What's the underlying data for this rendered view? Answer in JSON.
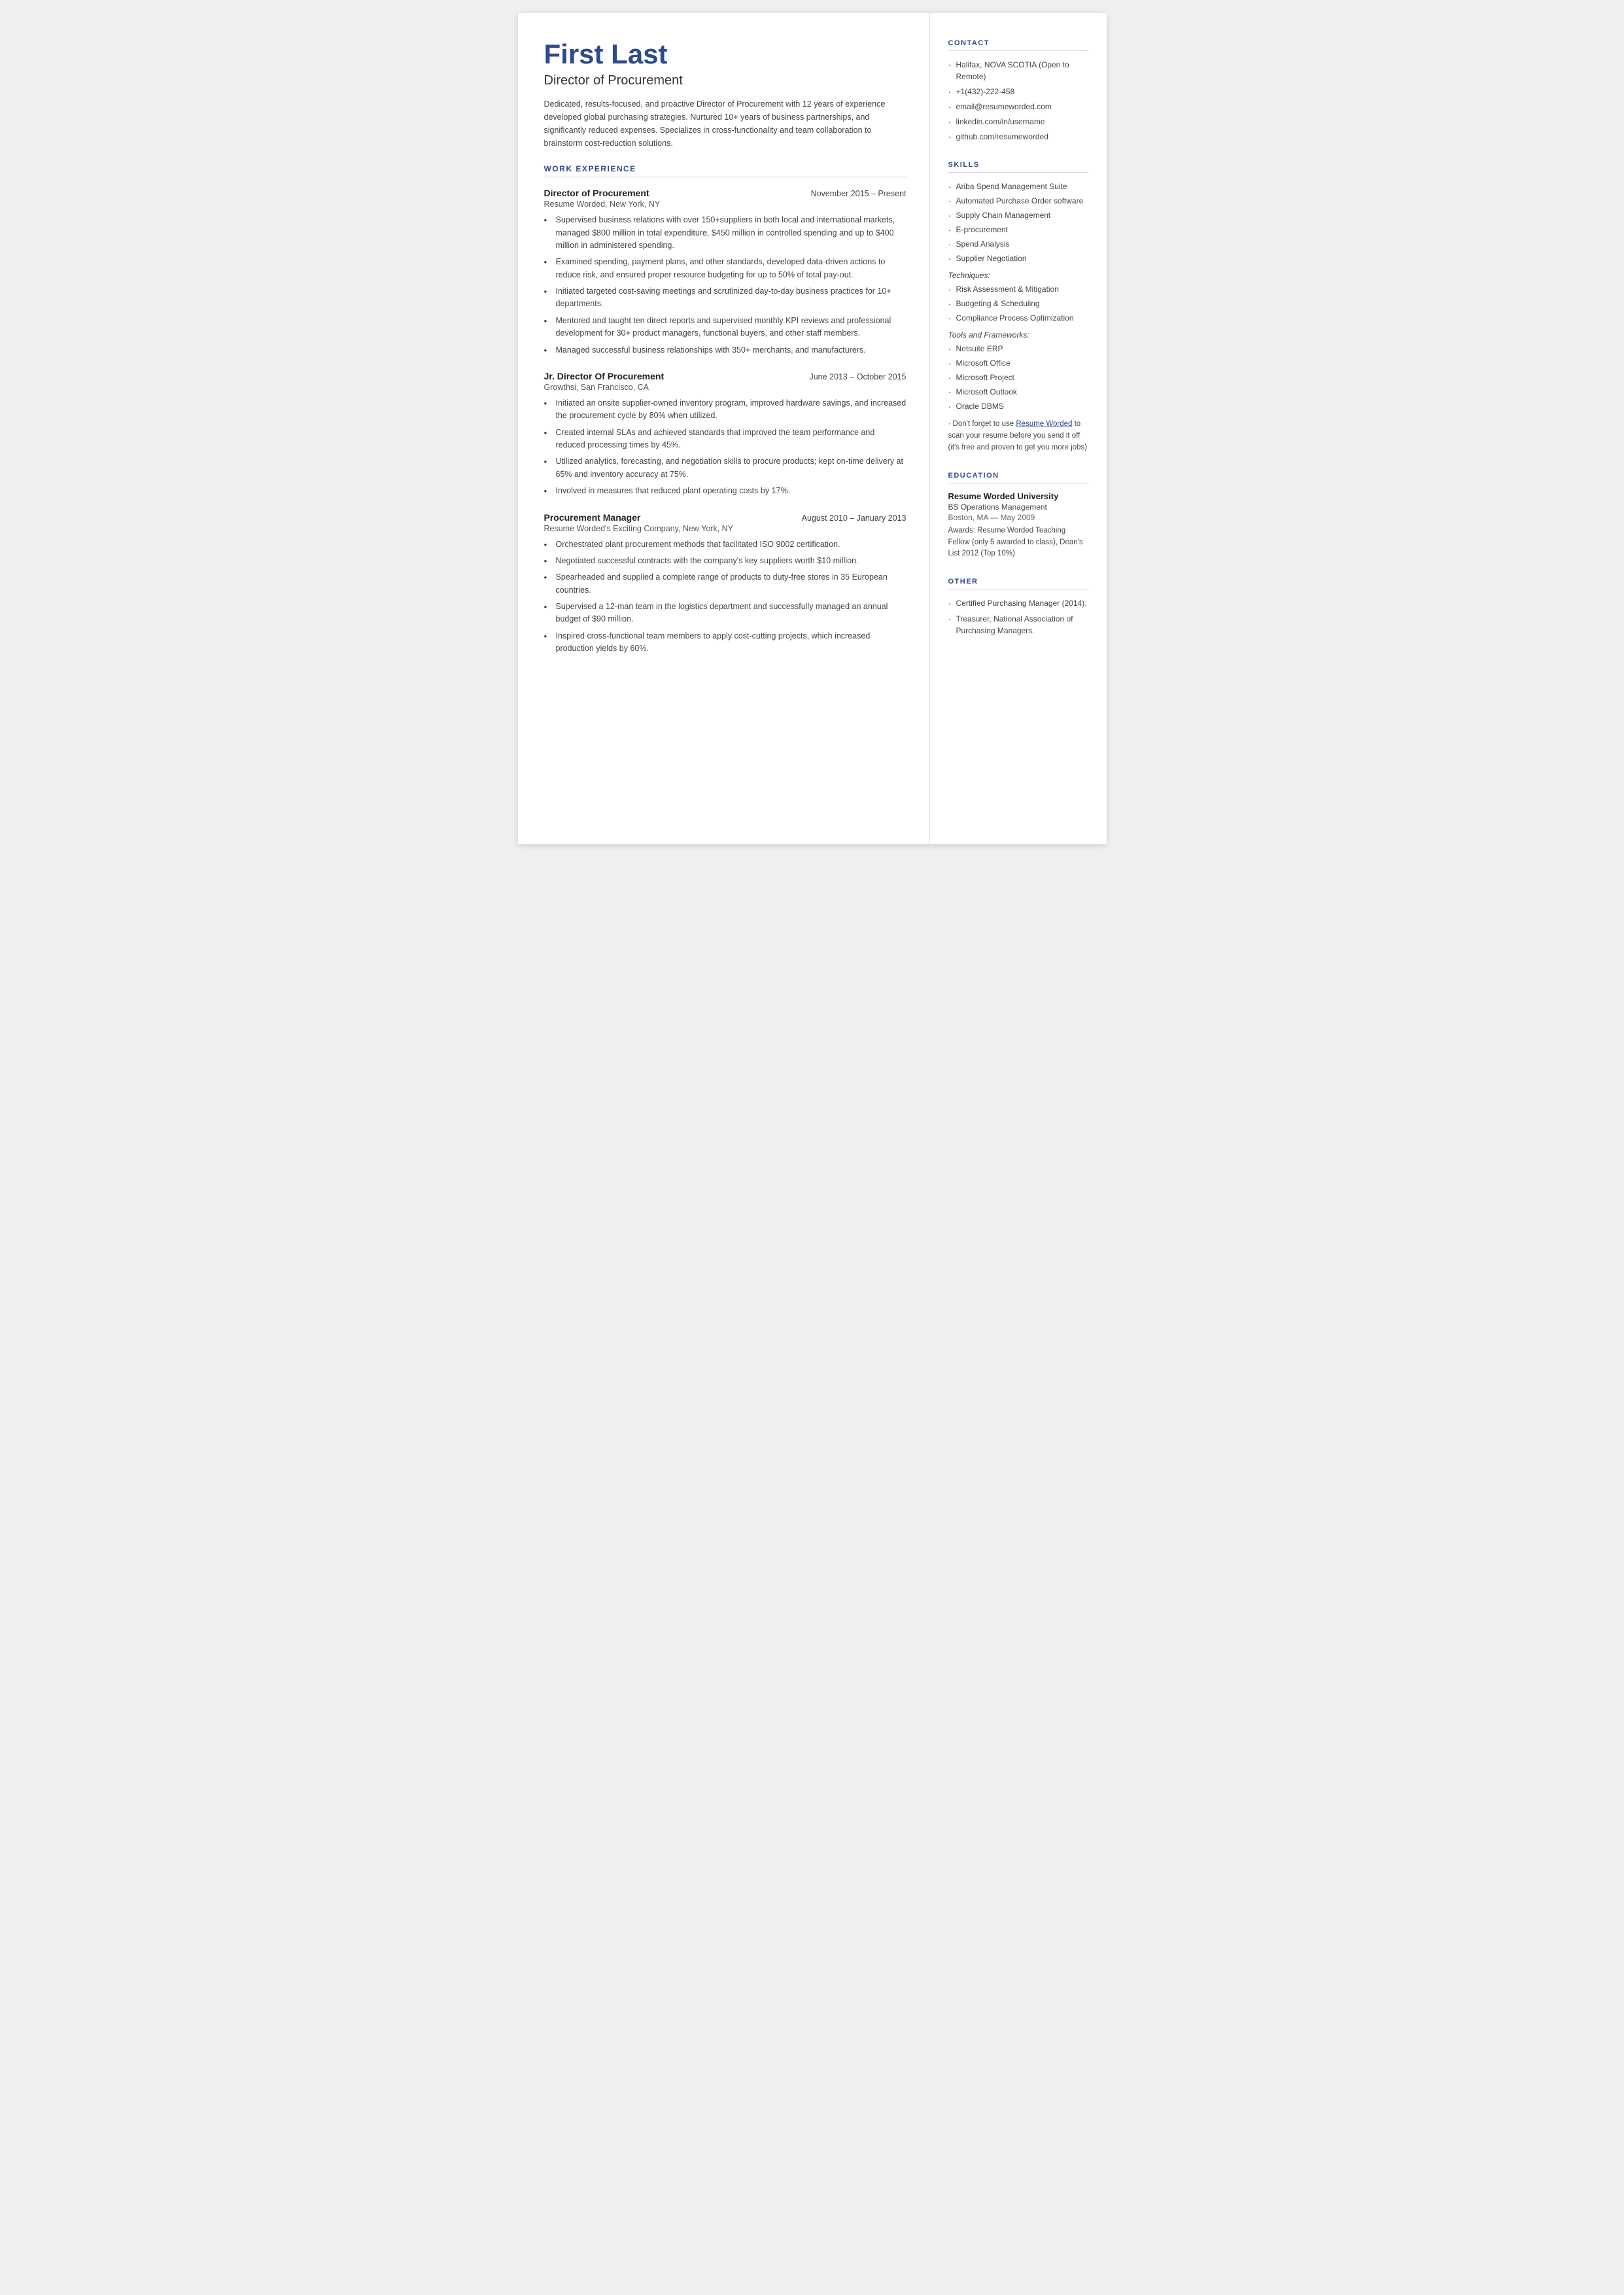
{
  "header": {
    "name": "First Last",
    "job_title": "Director of Procurement",
    "summary": "Dedicated, results-focused, and proactive Director of Procurement with 12 years of experience developed global purchasing strategies. Nurtured 10+ years of business partnerships, and significantly reduced expenses. Specializes in cross-functionality and team collaboration to brainstorm cost-reduction solutions."
  },
  "sections": {
    "work_experience_label": "WORK EXPERIENCE",
    "jobs": [
      {
        "position": "Director of Procurement",
        "dates": "November 2015 – Present",
        "company": "Resume Worded, New York, NY",
        "bullets": [
          "Supervised business relations with over 150+suppliers in both local and international markets, managed $800 million in total expenditure, $450 million in controlled spending and up to $400 million in administered spending.",
          "Examined spending, payment plans, and other standards, developed data-driven actions to reduce risk, and ensured proper resource budgeting for up to 50% of total pay-out.",
          "Initiated targeted cost-saving meetings and scrutinized day-to-day business practices for 10+ departments.",
          "Mentored and taught ten direct reports and supervised monthly KPI reviews and professional development for 30+ product managers, functional buyers, and other staff members.",
          "Managed successful business relationships with 350+ merchants, and manufacturers."
        ]
      },
      {
        "position": "Jr. Director Of Procurement",
        "dates": "June 2013 – October 2015",
        "company": "Growthsi, San Francisco, CA",
        "bullets": [
          "Initiated an onsite supplier-owned inventory program, improved hardware savings, and increased the procurement cycle by 80% when utilized.",
          "Created internal SLAs and achieved standards that improved the team performance and reduced processing times by 45%.",
          "Utilized analytics, forecasting, and negotiation skills to procure products; kept on-time delivery at 65% and inventory accuracy at 75%.",
          "Involved in measures that reduced plant operating costs by 17%."
        ]
      },
      {
        "position": "Procurement Manager",
        "dates": "August 2010 – January 2013",
        "company": "Resume Worded's Exciting Company, New York, NY",
        "bullets": [
          "Orchestrated plant procurement methods that facilitated ISO 9002 certification.",
          "Negotiated successful contracts with the company's key suppliers worth $10 million.",
          "Spearheaded and supplied a complete range of products to duty-free stores in 35 European countries.",
          "Supervised a 12-man team in the logistics department and successfully managed an annual budget of $90 million.",
          "Inspired cross-functional team members to apply cost-cutting projects, which increased production yields by 60%."
        ]
      }
    ]
  },
  "sidebar": {
    "contact": {
      "label": "CONTACT",
      "items": [
        "Halifax, NOVA SCOTIA (Open to Remote)",
        "+1(432)-222-458",
        "email@resumeworded.com",
        "linkedin.com/in/username",
        "github.com/resumeworded"
      ]
    },
    "skills": {
      "label": "SKILLS",
      "core_items": [
        "Ariba Spend Management Suite",
        "Automated Purchase Order software",
        "Supply Chain Management",
        "E-procurement",
        "Spend Analysis",
        "Supplier Negotiation"
      ],
      "techniques_label": "Techniques:",
      "techniques_items": [
        "Risk Assessment & Mitigation",
        "Budgeting & Scheduling",
        "Compliance Process Optimization"
      ],
      "tools_label": "Tools and Frameworks:",
      "tools_items": [
        "Netsuite ERP",
        "Microsoft Office",
        "Microsoft Project",
        "Microsoft Outlook",
        "Oracle DBMS"
      ],
      "note": "Don't forget to use Resume Worded to scan your resume before you send it off (it's free and proven to get you more jobs)",
      "note_link_text": "Resume Worded"
    },
    "education": {
      "label": "EDUCATION",
      "school": "Resume Worded University",
      "degree": "BS Operations Management",
      "location": "Boston, MA — May 2009",
      "awards": "Awards: Resume Worded Teaching Fellow (only 5 awarded to class), Dean's List 2012 (Top 10%)"
    },
    "other": {
      "label": "OTHER",
      "items": [
        "Certified Purchasing Manager (2014).",
        "Treasurer, National Association of Purchasing Managers."
      ]
    }
  }
}
